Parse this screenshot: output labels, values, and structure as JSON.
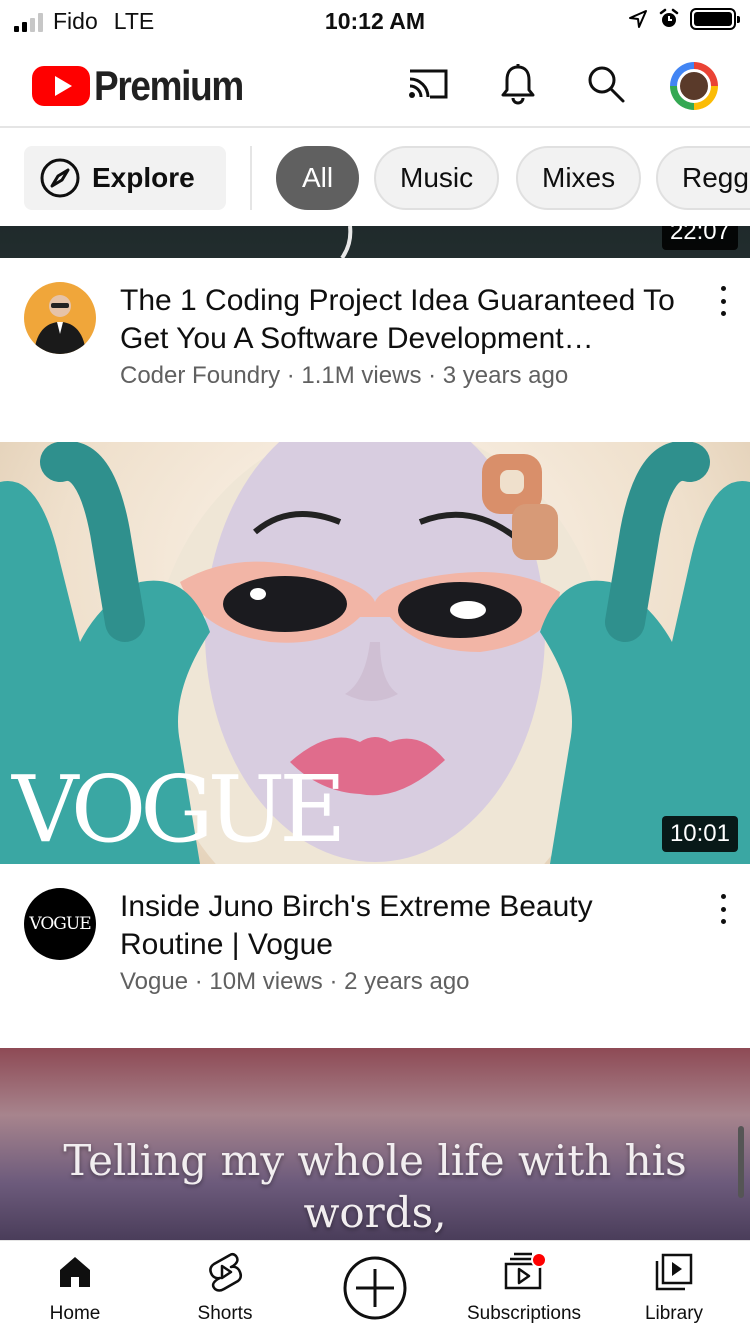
{
  "status_bar": {
    "carrier": "Fido",
    "network": "LTE",
    "time": "10:12 AM"
  },
  "header": {
    "logo_text": "Premium",
    "icons": [
      "cast-icon",
      "bell-icon",
      "search-icon",
      "account-avatar"
    ]
  },
  "chips": {
    "explore_label": "Explore",
    "items": [
      {
        "label": "All",
        "active": true
      },
      {
        "label": "Music",
        "active": false
      },
      {
        "label": "Mixes",
        "active": false
      },
      {
        "label": "Regga",
        "active": false
      }
    ]
  },
  "videos": [
    {
      "duration": "22:07",
      "title": "The 1 Coding Project Idea Guaranteed To Get You A Software Development…",
      "channel": "Coder Foundry",
      "views": "1.1M views",
      "age": "3 years ago",
      "meta": "Coder Foundry · 1.1M views · 3 years ago"
    },
    {
      "duration": "10:01",
      "thumbnail_text": "VOGUE",
      "channel_avatar_text": "VOGUE",
      "title": "Inside Juno Birch's Extreme Beauty Routine | Vogue",
      "channel": "Vogue",
      "views": "10M views",
      "age": "2 years ago",
      "meta": "Vogue · 10M views · 2 years ago"
    },
    {
      "thumbnail_text_line1": "Telling my whole life with his",
      "thumbnail_text_line2": "words,"
    }
  ],
  "bottom_nav": {
    "home": "Home",
    "shorts": "Shorts",
    "subscriptions": "Subscriptions",
    "library": "Library"
  },
  "colors": {
    "brand_red": "#ff0000",
    "chip_active": "#606060",
    "meta_text": "#606060",
    "glove_teal": "#3aa7a3"
  }
}
